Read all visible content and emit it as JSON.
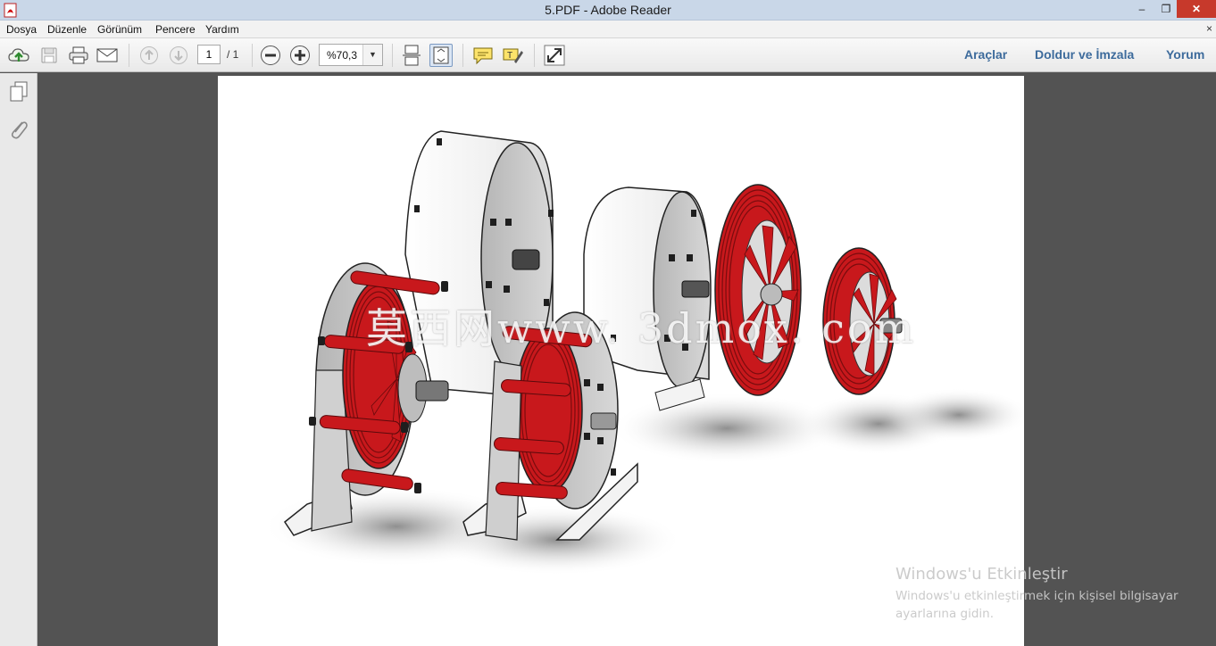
{
  "window": {
    "title": "5.PDF - Adobe Reader",
    "minimize_label": "‒",
    "maximize_label": "❐",
    "close_label": "✕"
  },
  "menu": {
    "items": [
      "Dosya",
      "Düzenle",
      "Görünüm",
      "Pencere",
      "Yardım"
    ],
    "close_label": "×"
  },
  "toolbar": {
    "page_number": "1",
    "page_total": "/ 1",
    "zoom_value": "%70,3",
    "zoom_arrow": "▼",
    "tools_label": "Araçlar",
    "fill_sign_label": "Doldur ve İmzala",
    "comment_label": "Yorum"
  },
  "document": {
    "watermark_text": "莫西网www. 3dmox. com",
    "colors": {
      "housing": "#f1f1f1",
      "plate": "#c9c9c9",
      "coil": "#c8181c",
      "bolt": "#1e1e1e"
    }
  },
  "activation": {
    "title": "Windows'u Etkinleştir",
    "line1": "Windows'u etkinleştirmek için kişisel bilgisayar",
    "line2": "ayarlarına gidin."
  }
}
